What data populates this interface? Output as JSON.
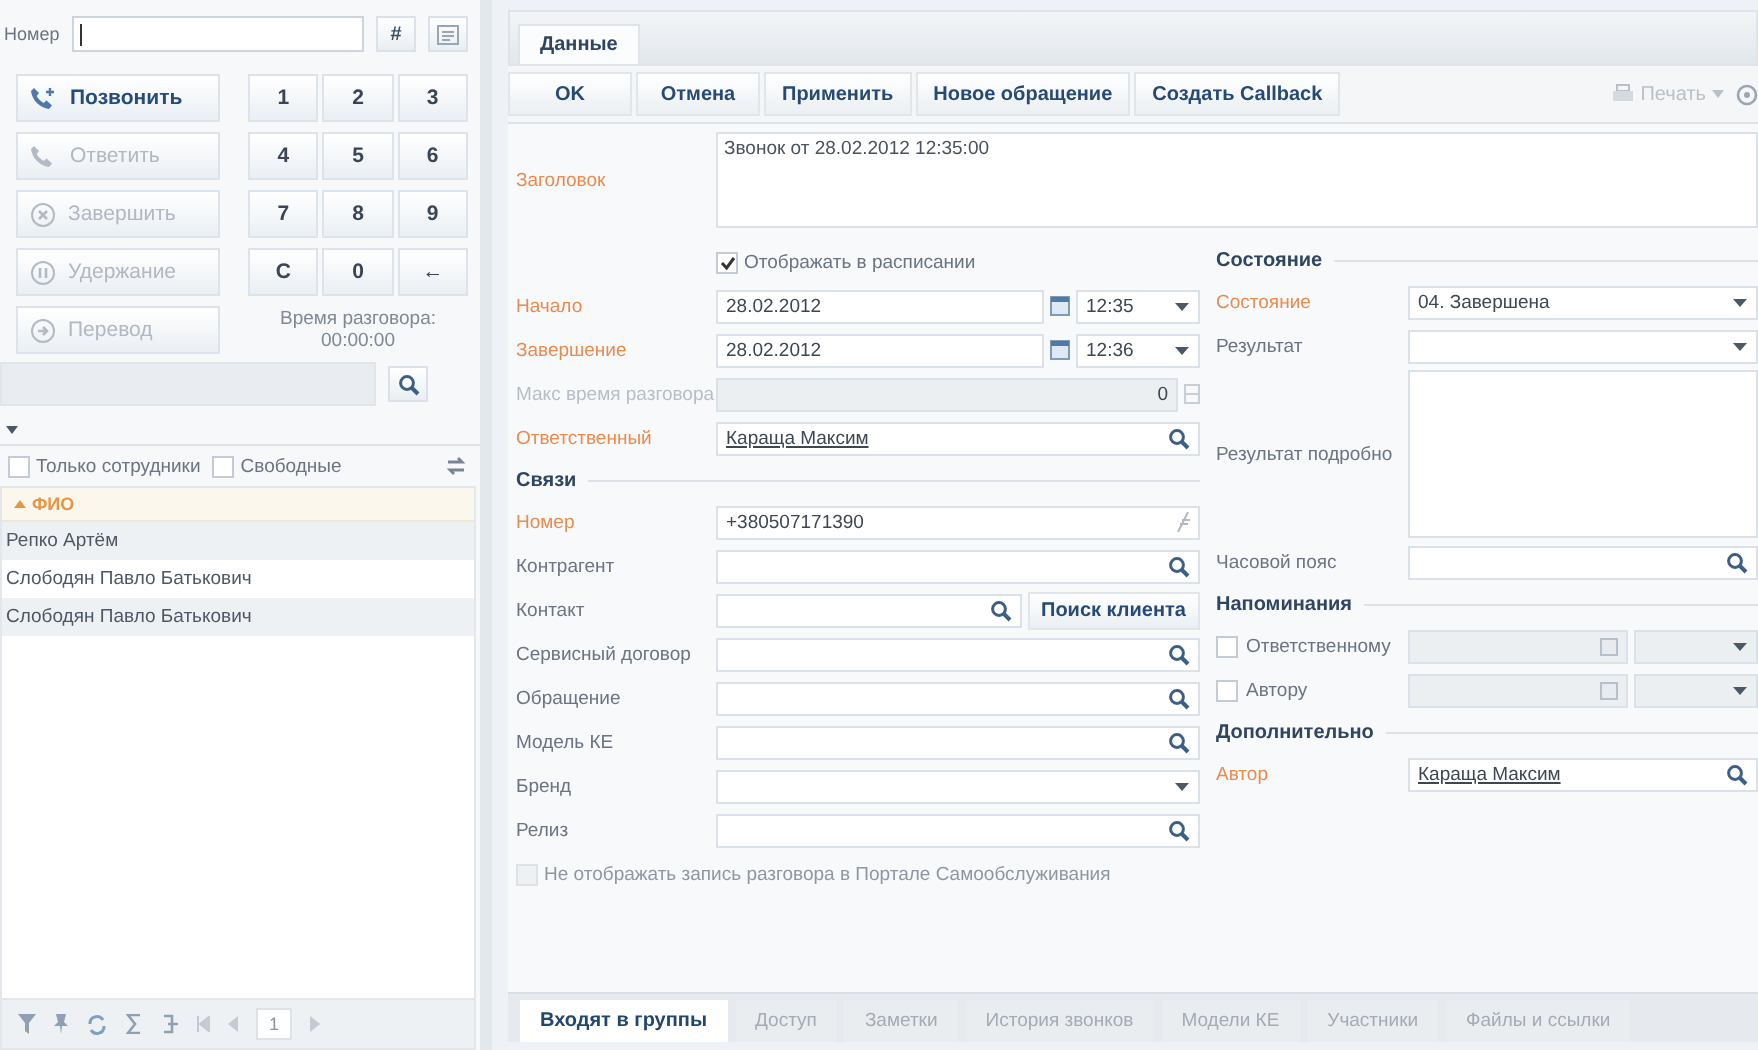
{
  "left_panel": {
    "number_label": "Номер",
    "hash_button": "#",
    "call_buttons": [
      {
        "label": "Позвонить",
        "kind": "call",
        "disabled": false
      },
      {
        "label": "Ответить",
        "kind": "answer",
        "disabled": true
      },
      {
        "label": "Завершить",
        "kind": "hangup",
        "disabled": true
      },
      {
        "label": "Удержание",
        "kind": "hold",
        "disabled": true
      },
      {
        "label": "Перевод",
        "kind": "transfer",
        "disabled": true
      }
    ],
    "keypad": [
      "1",
      "2",
      "3",
      "4",
      "5",
      "6",
      "7",
      "8",
      "9",
      "C",
      "0",
      "←"
    ],
    "talk_time": {
      "label": "Время разговора:",
      "value": "00:00:00"
    },
    "filters": [
      {
        "label": "Только сотрудники",
        "checked": false
      },
      {
        "label": "Свободные",
        "checked": false
      }
    ],
    "grid": {
      "column": "ФИО",
      "rows": [
        "Репко Артём",
        "Слободян Павло Батькович",
        "Слободян Павло Батькович"
      ]
    },
    "pager": {
      "page": "1"
    }
  },
  "card": {
    "tabs": [
      {
        "label": "Данные",
        "selected": true
      }
    ],
    "toolbar": [
      "OK",
      "Отмена",
      "Применить",
      "Новое обращение",
      "Создать Callback"
    ],
    "print": {
      "label": "Печать",
      "disabled": true
    },
    "title": {
      "label": "Заголовок",
      "required": true,
      "value": "Звонок от 28.02.2012 12:35:00"
    },
    "left_fields": [
      {
        "kind": "option",
        "label": "Отображать в расписании",
        "checked": true,
        "disabled": false
      },
      {
        "kind": "datetime",
        "label": "Начало",
        "required": true,
        "date": "28.02.2012",
        "time": "12:35"
      },
      {
        "kind": "datetime",
        "label": "Завершение",
        "required": true,
        "date": "28.02.2012",
        "time": "12:36"
      },
      {
        "kind": "number",
        "label": "Макс время разговора",
        "required": false,
        "disabled": true,
        "value": "0"
      },
      {
        "kind": "link",
        "label": "Ответственный",
        "required": true,
        "value": "Караща Максим"
      },
      {
        "kind": "section",
        "label": "Связи"
      },
      {
        "kind": "phone",
        "label": "Номер",
        "required": true,
        "value": "+380507171390"
      },
      {
        "kind": "lookup",
        "label": "Контрагент",
        "required": false
      },
      {
        "kind": "lookup",
        "label": "Контакт",
        "required": false,
        "button": "Поиск клиента"
      },
      {
        "kind": "lookup",
        "label": "Сервисный договор",
        "required": false
      },
      {
        "kind": "lookup",
        "label": "Обращение",
        "required": false
      },
      {
        "kind": "lookup",
        "label": "Модель КЕ",
        "required": false
      },
      {
        "kind": "dropdown",
        "label": "Бренд",
        "required": false
      },
      {
        "kind": "lookup",
        "label": "Релиз",
        "required": false
      },
      {
        "kind": "checkbox",
        "label": "Не отображать запись разговора в Портале Самообслуживания",
        "checked": false,
        "disabled": true
      }
    ],
    "right_fields": [
      {
        "kind": "section",
        "label": "Состояние"
      },
      {
        "kind": "dropdown",
        "label": "Состояние",
        "required": true,
        "value": "04. Завершена"
      },
      {
        "kind": "dropdown",
        "label": "Результат",
        "required": false
      },
      {
        "kind": "memo",
        "label": "Результат подробно",
        "required": false
      },
      {
        "kind": "lookup",
        "label": "Часовой пояс",
        "required": false
      },
      {
        "kind": "section",
        "label": "Напоминания"
      },
      {
        "kind": "reminder",
        "label": "Ответственному",
        "checked": false
      },
      {
        "kind": "reminder",
        "label": "Автору",
        "checked": false
      },
      {
        "kind": "section",
        "label": "Дополнительно"
      },
      {
        "kind": "link",
        "label": "Автор",
        "required": true,
        "value": "Караща Максим"
      }
    ],
    "bottom_tabs": [
      {
        "label": "Входят в группы",
        "selected": true
      },
      {
        "label": "Доступ",
        "selected": false
      },
      {
        "label": "Заметки",
        "selected": false
      },
      {
        "label": "История звонков",
        "selected": false
      },
      {
        "label": "Модели КЕ",
        "selected": false
      },
      {
        "label": "Участники",
        "selected": false
      },
      {
        "label": "Файлы и ссылки",
        "selected": false
      }
    ]
  }
}
